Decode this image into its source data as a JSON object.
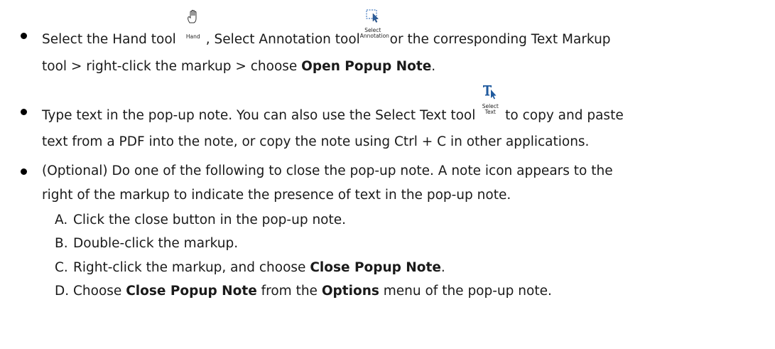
{
  "bullets": [
    {
      "line1": {
        "t1": "Select the Hand tool",
        "t2": ", Select Annotation tool",
        "t3": " or the corresponding Text Markup"
      },
      "line2": {
        "t1": "tool > right-click the markup > choose ",
        "bold": "Open Popup Note",
        "t2": "."
      }
    },
    {
      "line1": {
        "t1": "Type text in the pop-up note. You can also use the Select Text tool",
        "t2": " to copy and paste"
      },
      "line2": "text from a PDF into the note, or copy the note using Ctrl + C in other applications."
    },
    {
      "line1": "(Optional) Do one of the following to close the pop-up note. A note icon appears to the",
      "line2": "right of the markup to indicate the presence of text in the pop-up note."
    }
  ],
  "icons": {
    "hand": {
      "caption": "Hand",
      "icon": "hand-icon"
    },
    "select_annotation": {
      "caption_top": "Select",
      "caption_bottom": "Annotation",
      "icon": "select-annotation-icon"
    },
    "select_text": {
      "caption_top": "Select",
      "caption_bottom": "Text",
      "icon": "select-text-icon",
      "color": "#1f5a9e"
    }
  },
  "steps": [
    {
      "letter": "A.",
      "text": "Click the close button in the pop-up note."
    },
    {
      "letter": "B.",
      "text": "Double-click the markup."
    },
    {
      "letter": "C.",
      "t1": "Right-click the markup, and choose ",
      "bold": "Close Popup Note",
      "t2": "."
    },
    {
      "letter": "D.",
      "t1": "Choose ",
      "bold1": "Close Popup Note",
      "t2": " from the ",
      "bold2": "Options",
      "t3": " menu of the pop-up note."
    }
  ]
}
